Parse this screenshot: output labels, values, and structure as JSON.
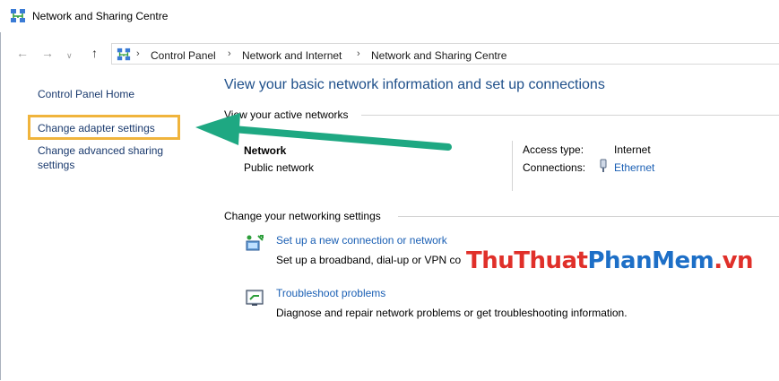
{
  "window": {
    "title": "Network and Sharing Centre",
    "title_icon": "network-sharing-icon"
  },
  "address": {
    "breadcrumbs": [
      "Control Panel",
      "Network and Internet",
      "Network and Sharing Centre"
    ],
    "icon": "network-sharing-icon"
  },
  "sidebar": {
    "items": [
      {
        "label": "Control Panel Home"
      },
      {
        "label": "Change adapter settings"
      },
      {
        "label": "Change advanced sharing settings"
      }
    ]
  },
  "main": {
    "heading": "View your basic network information and set up connections",
    "active_networks": {
      "label": "View your active networks",
      "network_name": "Network",
      "network_type": "Public network",
      "access_type_label": "Access type:",
      "access_type_value": "Internet",
      "connections_label": "Connections:",
      "connections_value": "Ethernet"
    },
    "networking_settings": {
      "label": "Change your networking settings",
      "tasks": [
        {
          "title": "Set up a new connection or network",
          "description": "Set up a broadband, dial-up or VPN co"
        },
        {
          "title": "Troubleshoot problems",
          "description": "Diagnose and repair network problems or get troubleshooting information."
        }
      ]
    }
  },
  "watermark": {
    "part1": "ThuThuat",
    "part2": "PhanMem",
    "part3": ".vn"
  },
  "colors": {
    "accent": "#1a5fb4",
    "highlight": "#f0b43c",
    "arrow": "#1ea882",
    "heading": "#1e4f8a"
  }
}
